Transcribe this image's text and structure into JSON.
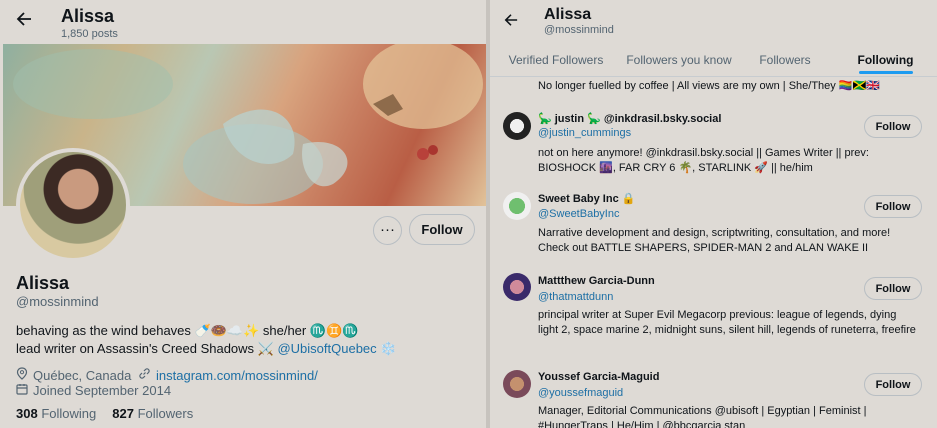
{
  "left": {
    "header": {
      "title": "Alissa",
      "posts": "1,850 posts"
    },
    "more_label": "···",
    "follow_label": "Follow",
    "name": "Alissa",
    "handle": "@mossinmind",
    "bio_line1": "behaving as the wind behaves 🍼🍩☁️✨ she/her ♏♊♏",
    "bio_line2_prefix": "lead writer on Assassin's Creed Shadows ⚔️",
    "bio_line2_link": "@UbisoftQuebec",
    "bio_line2_suffix": "❄️",
    "location": "Québec, Canada",
    "website": "instagram.com/mossinmind/",
    "joined": "Joined September 2014",
    "following_count": "308",
    "following_label": "Following",
    "followers_count": "827",
    "followers_label": "Followers"
  },
  "right": {
    "header": {
      "title": "Alissa",
      "handle": "@mossinmind"
    },
    "tabs": [
      "Verified Followers",
      "Followers you know",
      "Followers",
      "Following"
    ],
    "active_tab": "Following",
    "cut_text": "No longer fuelled by coffee | All views are my own | She/They 🏳️‍🌈🇯🇲🇬🇧",
    "users": [
      {
        "name": "🦕 justin 🦕 @inkdrasil.bsky.social",
        "handle": "@justin_cummings",
        "bio": "not on here anymore! @inkdrasil.bsky.social || Games Writer || prev: BIOSHOCK 🌆, FAR CRY 6 🌴, STARLINK 🚀 || he/him",
        "follow": "Follow"
      },
      {
        "name": "Sweet Baby Inc 🔒",
        "handle": "@SweetBabyInc",
        "bio": "Narrative development and design, scriptwriting, consultation, and more! Check out BATTLE SHAPERS, SPIDER-MAN 2 and ALAN WAKE II",
        "follow": "Follow"
      },
      {
        "name": "Mattthew Garcia-Dunn",
        "handle": "@thatmattdunn",
        "bio": "principal writer at Super Evil Megacorp previous: league of legends, dying light 2, space marine 2, midnight suns, silent hill, legends of runeterra, freefire",
        "follow": "Follow"
      },
      {
        "name": "Youssef Garcia-Maguid",
        "handle": "@youssefmaguid",
        "bio": "Manager, Editorial Communications @ubisoft | Egyptian | Feminist | #HungerTraps | He/Him | @bbcgarcia stan",
        "follow": "Follow"
      }
    ]
  },
  "colors": {
    "link": "#1d6fa5",
    "accent": "#1d9bf0",
    "background": "#dedad5"
  },
  "icons": {
    "back": "arrow-left-icon",
    "location": "location-pin-icon",
    "link": "link-icon",
    "calendar": "calendar-icon"
  }
}
